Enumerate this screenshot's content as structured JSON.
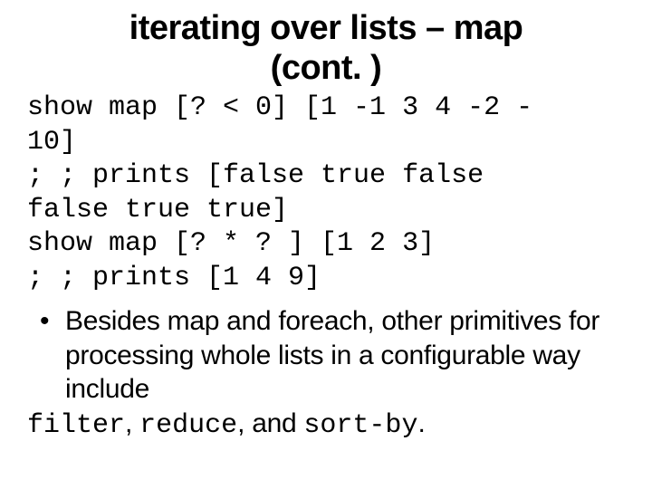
{
  "title": {
    "line1": "iterating over lists – map",
    "line2": "(cont. )"
  },
  "code": {
    "l1a": "show map [? < 0] [1 -1 3 4 -2 -",
    "l1b": "10]",
    "l2a": "; ; prints [false true false",
    "l2b": "false true true]",
    "l3": "show map [? * ? ] [1 2 3]",
    "l4": "; ; prints [1 4 9]"
  },
  "bullet": {
    "text": "Besides map and foreach, other primitives for processing whole lists in a configurable way include"
  },
  "tail": {
    "c1": "filter",
    "sep1": ", ",
    "c2": "reduce",
    "sep2": ", ",
    "joiner": "and ",
    "c3": "sort-by",
    "period": "."
  }
}
